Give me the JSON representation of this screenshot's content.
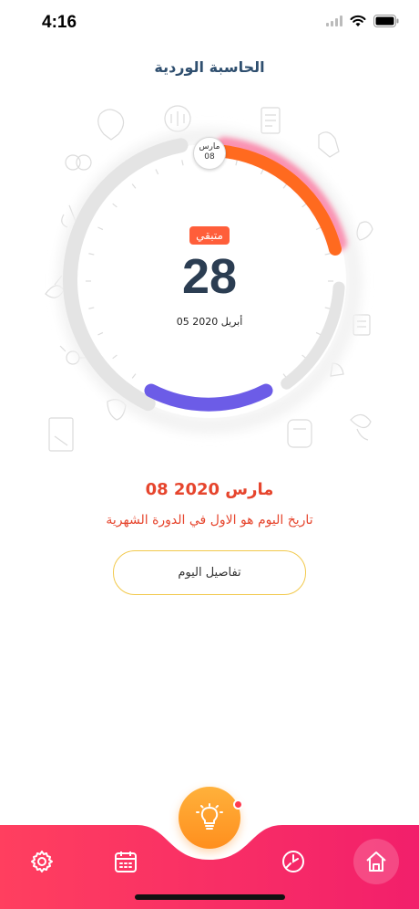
{
  "status_bar": {
    "time": "4:16"
  },
  "header": {
    "title": "الحاسبة الوردية"
  },
  "cycle": {
    "remaining_label": "متبقي",
    "days_remaining": "28",
    "next_date": "05 أبريل 2020",
    "marker_month": "مارس",
    "marker_day": "08",
    "colors": {
      "period": "#ff6a1f",
      "ovulation": "#6c5ce7",
      "track": "#e4e4e4",
      "accent": "#ff3c64"
    }
  },
  "today": {
    "date": "08 مارس 2020",
    "message": "تاريخ اليوم هو الاول في الدورة الشهرية",
    "details_button": "تفاصيل اليوم"
  },
  "nav": {
    "items": [
      {
        "name": "settings",
        "icon": "gear-icon"
      },
      {
        "name": "calendar",
        "icon": "calendar-icon"
      },
      {
        "name": "tips",
        "icon": "lightbulb-icon"
      },
      {
        "name": "history",
        "icon": "clock-icon"
      },
      {
        "name": "home",
        "icon": "home-icon"
      }
    ],
    "colors": {
      "start": "#ff3f5f",
      "end": "#f21f6b",
      "tip": "#ff9a25"
    }
  }
}
